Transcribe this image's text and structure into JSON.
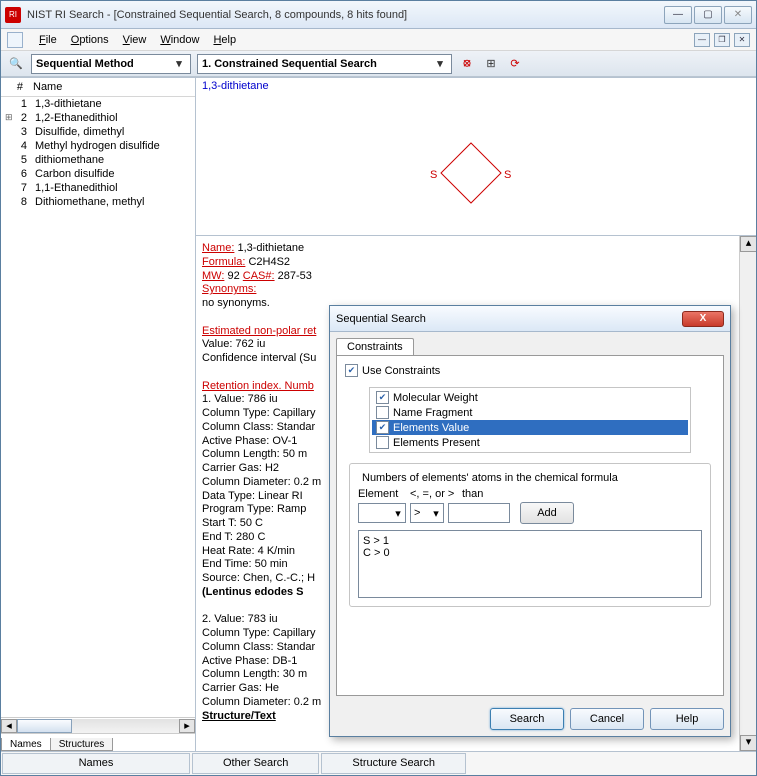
{
  "title": "NIST RI Search - [Constrained Sequential Search, 8 compounds,  8 hits found]",
  "menu": {
    "file": "File",
    "options": "Options",
    "view": "View",
    "window": "Window",
    "help": "Help"
  },
  "toolbar": {
    "method": "Sequential Method",
    "search_item": "1. Constrained Sequential Search"
  },
  "hitlist": {
    "col_num": "#",
    "col_name": "Name",
    "rows": [
      {
        "n": "1",
        "exp": "",
        "name": "1,3-dithietane"
      },
      {
        "n": "2",
        "exp": "⊞",
        "name": "1,2-Ethanedithiol"
      },
      {
        "n": "3",
        "exp": "",
        "name": "Disulfide, dimethyl"
      },
      {
        "n": "4",
        "exp": "",
        "name": "Methyl hydrogen disulfide"
      },
      {
        "n": "5",
        "exp": "",
        "name": "dithiomethane"
      },
      {
        "n": "6",
        "exp": "",
        "name": "Carbon disulfide"
      },
      {
        "n": "7",
        "exp": "",
        "name": "1,1-Ethanedithiol"
      },
      {
        "n": "8",
        "exp": "",
        "name": "Dithiomethane, methyl"
      }
    ],
    "tab_names": "Names",
    "tab_struct": "Structures"
  },
  "molview": {
    "name": "1,3-dithietane",
    "atom_left": "S",
    "atom_right": "S"
  },
  "detail": {
    "name_lbl": "Name:",
    "name": "1,3-dithietane",
    "formula_lbl": "Formula:",
    "formula": "C2H4S2",
    "mw_lbl": "MW:",
    "mw": "92",
    "cas_lbl": "CAS#:",
    "cas": "287-53",
    "syn_lbl": "Synonyms:",
    "syn": "no synonyms.",
    "est_hdr": "Estimated non-polar ret",
    "est_val": "Value: 762 iu",
    "est_ci": "Confidence interval (Su",
    "ri_hdr": "Retention index. Numb",
    "l1": "1. Value: 786 iu",
    "l2": "Column Type: Capillary",
    "l3": "Column Class: Standar",
    "l4": "Active Phase: OV-1",
    "l5": "Column Length: 50 m",
    "l6": "Carrier Gas: H2",
    "l7": "Column Diameter: 0.2 m",
    "l8": "Data Type: Linear RI",
    "l9": "Program Type: Ramp",
    "l10": "Start T: 50 C",
    "l11": "End T: 280 C",
    "l12": "Heat Rate: 4 K/min",
    "l13": "End Time: 50 min",
    "l14": "Source: Chen, C.-C.; H",
    "l15": "(Lentinus edodes S",
    "l16": "2. Value: 783 iu",
    "l17": "Column Type: Capillary",
    "l18": "Column Class: Standar",
    "l19": "Active Phase: DB-1",
    "l20": "Column Length: 30 m",
    "l21": "Carrier Gas: He",
    "l22": "Column Diameter: 0.2 m",
    "structtext": "Structure/Text"
  },
  "bottombar": {
    "names": "Names",
    "other": "Other Search",
    "struct": "Structure Search"
  },
  "dialog": {
    "title": "Sequential Search",
    "tab": "Constraints",
    "use": "Use Constraints",
    "opts": {
      "mw": "Molecular Weight",
      "nf": "Name Fragment",
      "ev": "Elements Value",
      "ep": "Elements Present"
    },
    "group_hdr": "Numbers of elements' atoms in the chemical formula",
    "lbl_elem": "Element",
    "lbl_op": "<, =, or >",
    "lbl_than": "than",
    "op_val": ">",
    "add": "Add",
    "list_l1": "S         >         1",
    "list_l2": "C         >         0",
    "search": "Search",
    "cancel": "Cancel",
    "help": "Help"
  }
}
